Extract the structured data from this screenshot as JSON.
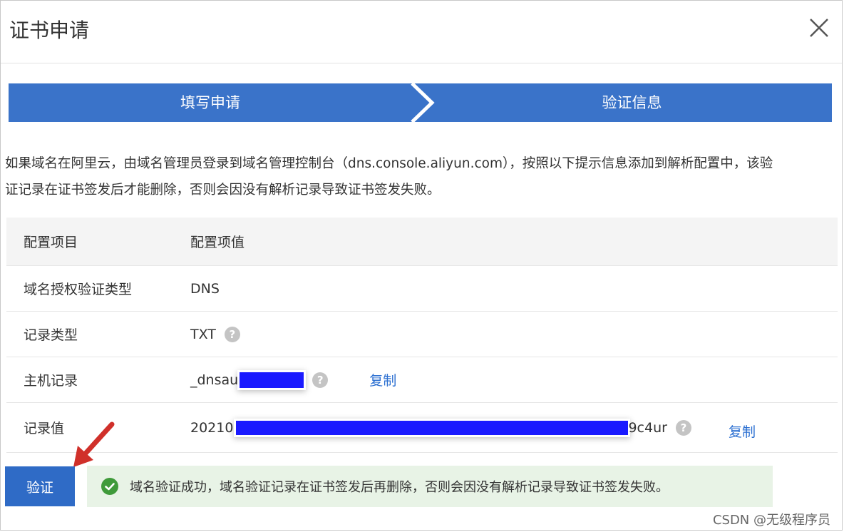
{
  "dialog": {
    "title": "证书申请",
    "close_glyph": "✕"
  },
  "steps": [
    {
      "label": "填写申请"
    },
    {
      "label": "验证信息"
    }
  ],
  "intro": {
    "line1": "如果域名在阿里云，由域名管理员登录到域名管理控制台（dns.console.aliyun.com），按照以下提示信息添加到解析配置中，该验",
    "line2": "证记录在证书签发后才能删除，否则会因没有解析记录导致证书签发失败。"
  },
  "table": {
    "header": {
      "key": "配置项目",
      "value": "配置项值"
    },
    "rows": [
      {
        "key": "域名授权验证类型",
        "value": "DNS"
      },
      {
        "key": "记录类型",
        "value": "TXT",
        "help": "?"
      },
      {
        "key": "主机记录",
        "value_prefix": "_dnsau",
        "help": "?",
        "copy": "复制"
      },
      {
        "key": "记录值",
        "value_prefix": "20210",
        "value_suffix": "9c4ur",
        "help": "?",
        "copy": "复制"
      }
    ]
  },
  "verify_button": "验证",
  "success_message": "域名验证成功，域名验证记录在证书签发后再删除，否则会因没有解析记录导致证书签发失败。",
  "watermark": "CSDN @无级程序员",
  "colors": {
    "step_bar": "#3a73c9",
    "primary_button": "#2f6bc6",
    "success_bg": "#e8f3e6",
    "success_icon": "#3f9a3a",
    "link": "#2b6fd1",
    "redaction": "#1a1aff",
    "arrow": "#d0302a"
  }
}
